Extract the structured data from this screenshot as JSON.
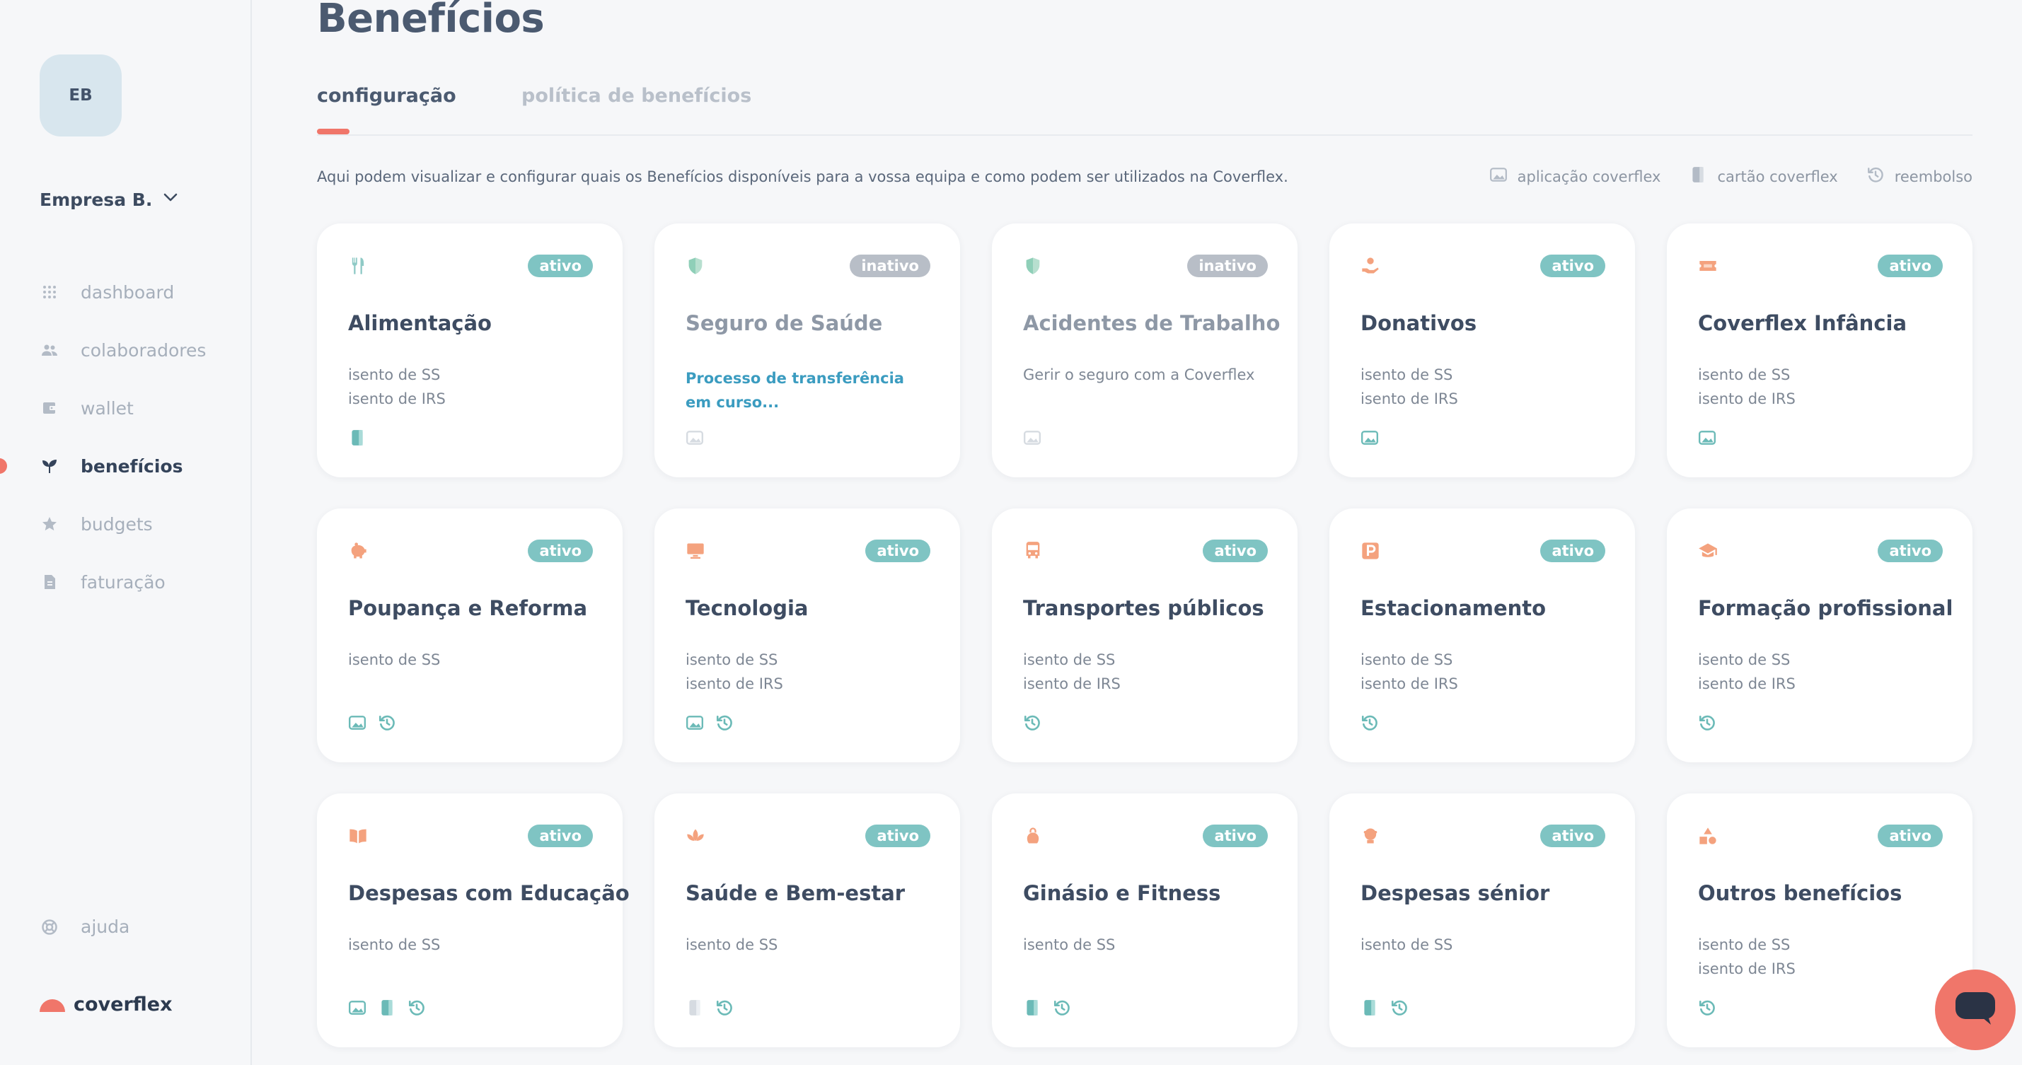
{
  "sidebar": {
    "avatar_initials": "EB",
    "company_name": "Empresa B.",
    "nav": [
      {
        "label": "dashboard",
        "icon": "grid-icon",
        "active": false
      },
      {
        "label": "colaboradores",
        "icon": "people-icon",
        "active": false
      },
      {
        "label": "wallet",
        "icon": "wallet-icon",
        "active": false
      },
      {
        "label": "benefícios",
        "icon": "sprout-icon",
        "active": true
      },
      {
        "label": "budgets",
        "icon": "star-icon",
        "active": false
      },
      {
        "label": "faturação",
        "icon": "invoice-icon",
        "active": false
      }
    ],
    "help_label": "ajuda",
    "brand_name": "coverflex"
  },
  "main": {
    "title": "Benefícios",
    "tabs": [
      {
        "label": "configuração",
        "active": true
      },
      {
        "label": "política de benefícios",
        "active": false
      }
    ],
    "description": "Aqui podem visualizar e configurar quais os Benefícios disponíveis para a vossa equipa e como podem ser utilizados na Coverflex.",
    "legend": [
      {
        "label": "aplicação coverflex",
        "icon": "app-icon"
      },
      {
        "label": "cartão coverflex",
        "icon": "card-icon"
      },
      {
        "label": "reembolso",
        "icon": "refund-icon"
      }
    ]
  },
  "colors": {
    "active_badge": "#7fc4c3",
    "inactive_badge": "#b8bec7",
    "accent": "#f0766a",
    "category_icon": "#f4a27e",
    "feature_icon": "#6bbab7",
    "link": "#3b9cc0"
  },
  "cards": [
    {
      "title": "Alimentação",
      "status": "ativo",
      "icon": "cutlery-icon",
      "lines": [
        "isento de SS",
        "isento de IRS"
      ],
      "features": [
        "card-icon"
      ]
    },
    {
      "title": "Seguro de Saúde",
      "status": "inativo",
      "icon": "shield-icon",
      "link": "Processo de transferência em curso...",
      "features": [
        "app-icon"
      ]
    },
    {
      "title": "Acidentes de Trabalho",
      "status": "inativo",
      "icon": "shield-icon",
      "lines": [
        "Gerir o seguro com a Coverflex"
      ],
      "features": [
        "app-icon"
      ]
    },
    {
      "title": "Donativos",
      "status": "ativo",
      "icon": "donation-icon",
      "lines": [
        "isento de SS",
        "isento de IRS"
      ],
      "features": [
        "app-icon"
      ]
    },
    {
      "title": "Coverflex Infância",
      "status": "ativo",
      "icon": "ticket-icon",
      "lines": [
        "isento de SS",
        "isento de IRS"
      ],
      "features": [
        "app-icon"
      ]
    },
    {
      "title": "Poupança e Reforma",
      "status": "ativo",
      "icon": "piggy-bank-icon",
      "lines": [
        "isento de SS"
      ],
      "features": [
        "app-icon",
        "refund-icon"
      ]
    },
    {
      "title": "Tecnologia",
      "status": "ativo",
      "icon": "monitor-icon",
      "lines": [
        "isento de SS",
        "isento de IRS"
      ],
      "features": [
        "app-icon",
        "refund-icon"
      ]
    },
    {
      "title": "Transportes públicos",
      "status": "ativo",
      "icon": "bus-icon",
      "lines": [
        "isento de SS",
        "isento de IRS"
      ],
      "features": [
        "refund-icon"
      ]
    },
    {
      "title": "Estacionamento",
      "status": "ativo",
      "icon": "parking-icon",
      "lines": [
        "isento de SS",
        "isento de IRS"
      ],
      "features": [
        "refund-icon"
      ]
    },
    {
      "title": "Formação profissional",
      "status": "ativo",
      "icon": "graduation-cap-icon",
      "lines": [
        "isento de SS",
        "isento de IRS"
      ],
      "features": [
        "refund-icon"
      ]
    },
    {
      "title": "Despesas com Educação",
      "status": "ativo",
      "icon": "book-icon",
      "lines": [
        "isento de SS"
      ],
      "features": [
        "app-icon",
        "card-icon",
        "refund-icon"
      ]
    },
    {
      "title": "Saúde e Bem-estar",
      "status": "ativo",
      "icon": "lotus-icon",
      "lines": [
        "isento de SS"
      ],
      "features": [
        "card-icon-faded",
        "refund-icon"
      ]
    },
    {
      "title": "Ginásio e Fitness",
      "status": "ativo",
      "icon": "kettlebell-icon",
      "lines": [
        "isento de SS"
      ],
      "features": [
        "card-icon",
        "refund-icon"
      ]
    },
    {
      "title": "Despesas sénior",
      "status": "ativo",
      "icon": "senior-icon",
      "lines": [
        "isento de SS"
      ],
      "features": [
        "card-icon",
        "refund-icon"
      ]
    },
    {
      "title": "Outros benefícios",
      "status": "ativo",
      "icon": "shapes-icon",
      "lines": [
        "isento de SS",
        "isento de IRS"
      ],
      "features": [
        "refund-icon"
      ]
    }
  ],
  "chat": {
    "icon": "chat-icon"
  }
}
